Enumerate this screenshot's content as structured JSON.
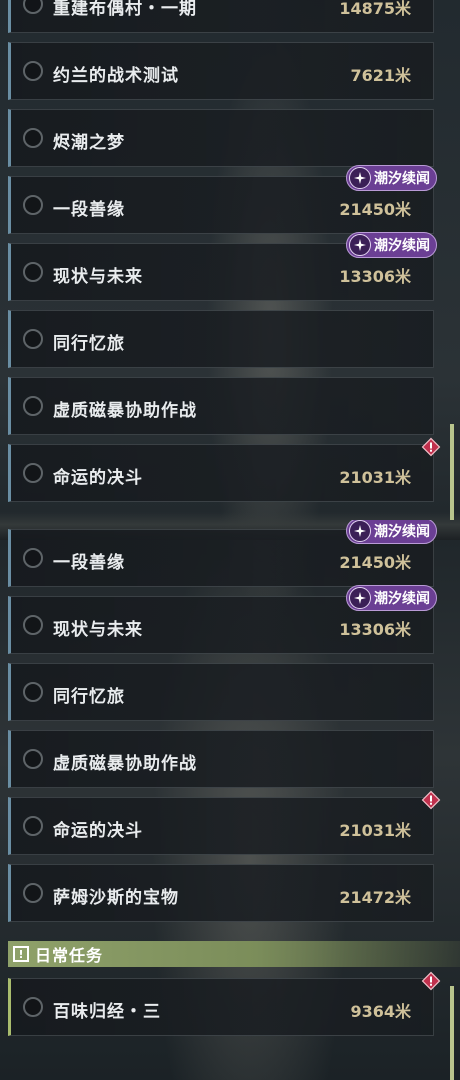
{
  "accent_color": "#a9bd6e",
  "badge_color": "#6b3f94",
  "distance_color": "#cfc19a",
  "top_list": [
    {
      "title": "重建布偶村・一期",
      "distance": "14875米",
      "badge": null,
      "alert": false
    },
    {
      "title": "约兰的战术测试",
      "distance": "7621米",
      "badge": null,
      "alert": false
    },
    {
      "title": "烬潮之梦",
      "distance": "",
      "badge": null,
      "alert": false
    },
    {
      "title": "一段善缘",
      "distance": "21450米",
      "badge": "潮汐续闻",
      "alert": false
    },
    {
      "title": "现状与未来",
      "distance": "13306米",
      "badge": "潮汐续闻",
      "alert": false
    },
    {
      "title": "同行忆旅",
      "distance": "",
      "badge": null,
      "alert": false
    },
    {
      "title": "虚质磁暴协助作战",
      "distance": "",
      "badge": null,
      "alert": false
    },
    {
      "title": "命运的决斗",
      "distance": "21031米",
      "badge": null,
      "alert": true
    }
  ],
  "bottom_list": [
    {
      "title": "一段善缘",
      "distance": "21450米",
      "badge": "潮汐续闻",
      "alert": false
    },
    {
      "title": "现状与未来",
      "distance": "13306米",
      "badge": "潮汐续闻",
      "alert": false
    },
    {
      "title": "同行忆旅",
      "distance": "",
      "badge": null,
      "alert": false
    },
    {
      "title": "虚质磁暴协助作战",
      "distance": "",
      "badge": null,
      "alert": false
    },
    {
      "title": "命运的决斗",
      "distance": "21031米",
      "badge": null,
      "alert": true
    },
    {
      "title": "萨姆沙斯的宝物",
      "distance": "21472米",
      "badge": null,
      "alert": false
    }
  ],
  "daily_section": {
    "title": "日常任务",
    "icon": "exclamation-square-icon",
    "items": [
      {
        "title": "百味归经・三",
        "distance": "9364米",
        "badge": null,
        "alert": true
      }
    ]
  }
}
